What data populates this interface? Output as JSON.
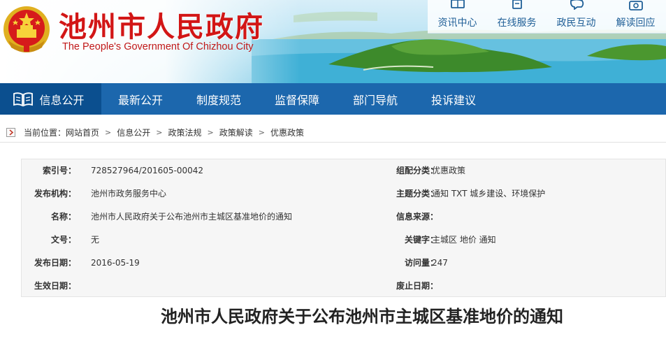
{
  "header": {
    "title": "池州市人民政府",
    "subtitle": "The People's Government Of Chizhou City",
    "quick_links": [
      {
        "icon": "news-icon",
        "label": "资讯中心"
      },
      {
        "icon": "online-service-icon",
        "label": "在线服务"
      },
      {
        "icon": "interaction-icon",
        "label": "政民互动"
      },
      {
        "icon": "camera-icon",
        "label": "解读回应"
      }
    ],
    "banner_colors": {
      "title": "#d21616",
      "water": "#5bbad9",
      "forest": "#3f8a2e"
    }
  },
  "nav": {
    "active": {
      "label": "信息公开",
      "icon": "book-icon"
    },
    "items": [
      "最新公开",
      "制度规范",
      "监督保障",
      "部门导航",
      "投诉建议"
    ],
    "background": "#1c67ad"
  },
  "breadcrumb": {
    "prefix": "当前位置：",
    "items": [
      "网站首页",
      "信息公开",
      "政策法规",
      "政策解读",
      "优惠政策"
    ],
    "separator": ">"
  },
  "info": {
    "rows": [
      {
        "left_label": "索引号：",
        "left_value": "728527964/201605-00042",
        "right_label": "组配分类：",
        "right_value": "优惠政策"
      },
      {
        "left_label": "发布机构：",
        "left_value": "池州市政务服务中心",
        "right_label": "主题分类：",
        "right_value": "通知   TXT   城乡建设、环境保护"
      },
      {
        "left_label": "名称：",
        "left_value": "池州市人民政府关于公布池州市主城区基准地价的通知",
        "right_label": "信息来源：",
        "right_value": ""
      },
      {
        "left_label": "文号：",
        "left_value": "无",
        "right_label": "关键字：",
        "right_value": "主城区   地价   通知"
      },
      {
        "left_label": "发布日期：",
        "left_value": "2016-05-19",
        "right_label": "访问量：",
        "right_value": "247"
      },
      {
        "left_label": "生效日期：",
        "left_value": "",
        "right_label": "废止日期：",
        "right_value": ""
      }
    ]
  },
  "article": {
    "title": "池州市人民政府关于公布池州市主城区基准地价的通知"
  }
}
